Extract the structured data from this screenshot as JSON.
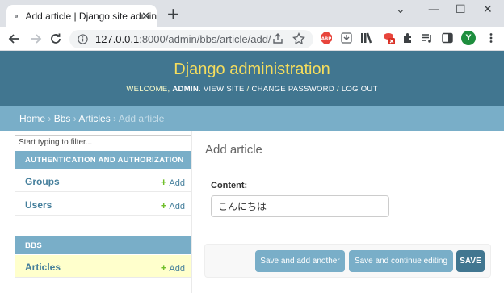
{
  "browser": {
    "tab_title": "Add article | Django site admin",
    "tab_close": "✕",
    "new_tab": "+",
    "window_controls": [
      "⌄",
      "—",
      "☐",
      "✕"
    ],
    "url_host": "127.0.0.1",
    "url_path": ":8000/admin/bbs/article/add/",
    "profile_initial": "Y",
    "colors": {
      "tabbar": "#dee1e6",
      "profile": "#1e8e3e",
      "abp": "#e8453c"
    }
  },
  "header": {
    "branding": "Django administration",
    "welcome": "WELCOME, ",
    "user": "ADMIN",
    "view_site": "VIEW SITE",
    "change_password": "CHANGE PASSWORD",
    "logout": "LOG OUT",
    "separator": " / "
  },
  "breadcrumbs": {
    "home": "Home",
    "app": "Bbs",
    "model": "Articles",
    "current": "Add article",
    "sep": " › "
  },
  "sidebar": {
    "filter_placeholder": "Start typing to filter...",
    "apps": [
      {
        "caption": "AUTHENTICATION AND AUTHORIZATION",
        "models": [
          {
            "name": "Groups",
            "add": "Add"
          },
          {
            "name": "Users",
            "add": "Add"
          }
        ]
      },
      {
        "caption": "BBS",
        "models": [
          {
            "name": "Articles",
            "add": "Add"
          }
        ]
      }
    ],
    "add_plus": "+"
  },
  "content": {
    "title": "Add article",
    "field_label": "Content:",
    "field_value": "こんにちは"
  },
  "submit": {
    "save_add_another": "Save and add another",
    "save_continue": "Save and continue editing",
    "save": "SAVE"
  }
}
